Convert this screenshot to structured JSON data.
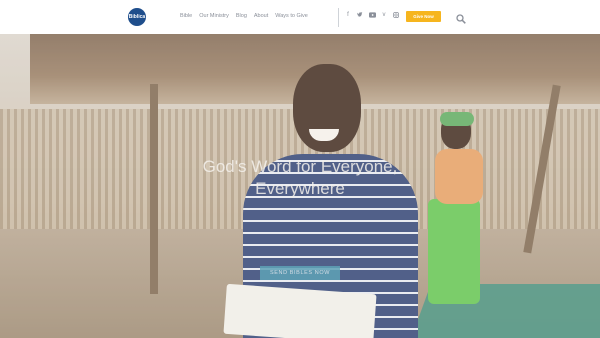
{
  "header": {
    "logo_text": "Biblica",
    "nav": [
      "Bible",
      "Our Ministry",
      "Blog",
      "About",
      "Ways to Give"
    ],
    "social_icons": [
      "facebook-icon",
      "twitter-icon",
      "youtube-icon",
      "vimeo-icon",
      "instagram-icon"
    ],
    "give_button": "Give Now",
    "give_color": "#f6b51e"
  },
  "hero": {
    "title_line1": "God's Word for Everyone,",
    "title_line2": "Everywhere",
    "button_label": "SEND BIBLES NOW",
    "button_color": "#5fa2b6"
  }
}
